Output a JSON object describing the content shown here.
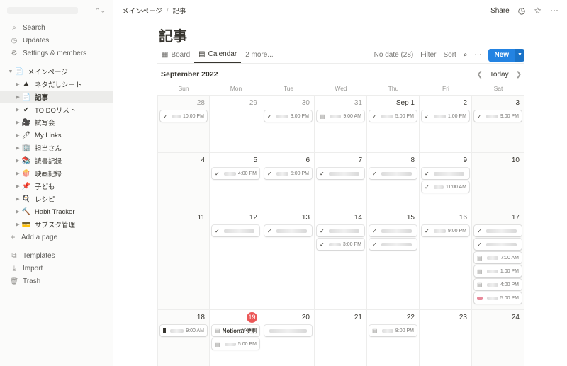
{
  "sidebar": {
    "top_items": [
      {
        "label": "Search",
        "icon": "search-icon"
      },
      {
        "label": "Updates",
        "icon": "clock-icon"
      },
      {
        "label": "Settings & members",
        "icon": "gear-icon"
      }
    ],
    "root_page": "メインページ",
    "pages": [
      {
        "label": "ネタだしシート",
        "icon": "⛰"
      },
      {
        "label": "記事",
        "icon": "📄"
      },
      {
        "label": "TO DOリスト",
        "icon": "✔"
      },
      {
        "label": "試写会",
        "icon": "🎥"
      },
      {
        "label": "My Links",
        "icon": "🖊"
      },
      {
        "label": "担当さん",
        "icon": "🏢"
      },
      {
        "label": "読書記録",
        "icon": "📚"
      },
      {
        "label": "映画記録",
        "icon": "🍿"
      },
      {
        "label": "子ども",
        "icon": "📌"
      },
      {
        "label": "レシピ",
        "icon": "🍳"
      },
      {
        "label": "Habit Tracker",
        "icon": "🔨"
      },
      {
        "label": "サブスク管理",
        "icon": "💳"
      }
    ],
    "add_page": "Add a page",
    "bottom_items": [
      {
        "label": "Templates",
        "icon": "templates-icon"
      },
      {
        "label": "Import",
        "icon": "import-icon"
      },
      {
        "label": "Trash",
        "icon": "trash-icon"
      }
    ]
  },
  "breadcrumb": {
    "root": "メインページ",
    "current": "記事"
  },
  "topbar": {
    "share": "Share"
  },
  "page": {
    "title": "記事"
  },
  "views": {
    "tabs": [
      {
        "label": "Board"
      },
      {
        "label": "Calendar"
      }
    ],
    "more": "2 more...",
    "no_date": "No date (28)",
    "filter": "Filter",
    "sort": "Sort",
    "new": "New"
  },
  "calendar": {
    "month": "September 2022",
    "today_label": "Today",
    "weekdays": [
      "Sun",
      "Mon",
      "Tue",
      "Wed",
      "Thu",
      "Fri",
      "Sat"
    ],
    "weeks": [
      [
        {
          "day": "28",
          "other": true,
          "events": [
            {
              "kind": "check",
              "time": "10:00 PM"
            }
          ]
        },
        {
          "day": "29",
          "other": true,
          "events": []
        },
        {
          "day": "30",
          "other": true,
          "events": [
            {
              "kind": "check",
              "time": "3:00 PM"
            }
          ]
        },
        {
          "day": "31",
          "other": true,
          "events": [
            {
              "kind": "doc",
              "title": "【",
              "time": "9:00 AM"
            }
          ]
        },
        {
          "day": "Sep 1",
          "events": [
            {
              "kind": "check",
              "time": "5:00 PM"
            }
          ]
        },
        {
          "day": "2",
          "events": [
            {
              "kind": "check",
              "title": "「",
              "time": "1:00 PM"
            }
          ]
        },
        {
          "day": "3",
          "events": [
            {
              "kind": "check",
              "time": "9:00 PM"
            }
          ]
        }
      ],
      [
        {
          "day": "4",
          "events": []
        },
        {
          "day": "5",
          "events": [
            {
              "kind": "check",
              "title": "L",
              "time": "4:00 PM"
            }
          ]
        },
        {
          "day": "6",
          "events": [
            {
              "kind": "check",
              "title": "「",
              "time": "5:00 PM"
            }
          ]
        },
        {
          "day": "7",
          "events": [
            {
              "kind": "check",
              "time": ""
            }
          ]
        },
        {
          "day": "8",
          "events": [
            {
              "kind": "check",
              "time": ""
            }
          ]
        },
        {
          "day": "9",
          "events": [
            {
              "kind": "check",
              "time": ""
            },
            {
              "kind": "check",
              "time": "11:00 AM"
            }
          ]
        },
        {
          "day": "10",
          "events": []
        }
      ],
      [
        {
          "day": "11",
          "events": []
        },
        {
          "day": "12",
          "events": [
            {
              "kind": "check",
              "title": "「",
              "time": ""
            }
          ]
        },
        {
          "day": "13",
          "events": [
            {
              "kind": "check",
              "time": ""
            }
          ]
        },
        {
          "day": "14",
          "events": [
            {
              "kind": "check",
              "time": ""
            },
            {
              "kind": "check",
              "title": "【",
              "time": "3:00 PM"
            }
          ]
        },
        {
          "day": "15",
          "events": [
            {
              "kind": "check",
              "title": "「",
              "time": ""
            },
            {
              "kind": "check",
              "time": ""
            }
          ]
        },
        {
          "day": "16",
          "events": [
            {
              "kind": "check",
              "title": "【",
              "time": "9:00 PM"
            }
          ]
        },
        {
          "day": "17",
          "events": [
            {
              "kind": "check",
              "time": ""
            },
            {
              "kind": "check",
              "time": ""
            },
            {
              "kind": "doc",
              "time": "7:00 AM"
            },
            {
              "kind": "doc",
              "time": "1:00 PM"
            },
            {
              "kind": "doc",
              "time": "4:00 PM"
            },
            {
              "kind": "pink",
              "time": "5:00 PM"
            }
          ]
        }
      ],
      [
        {
          "day": "18",
          "events": [
            {
              "kind": "block",
              "time": "9:00 AM"
            }
          ]
        },
        {
          "day": "19",
          "today": true,
          "events": [
            {
              "kind": "doc",
              "title": "Notionが便利",
              "time": ""
            },
            {
              "kind": "doc",
              "time": "5:00 PM"
            }
          ]
        },
        {
          "day": "20",
          "events": [
            {
              "kind": "plain",
              "time": ""
            }
          ]
        },
        {
          "day": "21",
          "events": []
        },
        {
          "day": "22",
          "events": [
            {
              "kind": "doc",
              "time": "8:00 PM"
            }
          ]
        },
        {
          "day": "23",
          "events": []
        },
        {
          "day": "24",
          "events": []
        }
      ]
    ]
  }
}
